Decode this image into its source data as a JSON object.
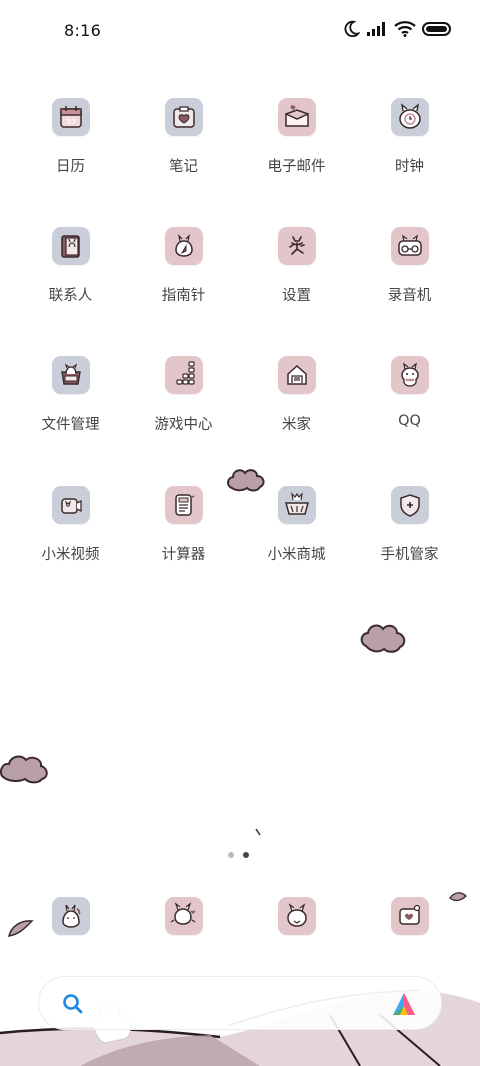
{
  "status_bar": {
    "time": "8:16",
    "icons": [
      "moon-icon",
      "signal-icon",
      "wifi-icon",
      "battery-icon"
    ]
  },
  "apps": [
    {
      "name": "日历",
      "icon": "calendar-icon",
      "tile": "blue"
    },
    {
      "name": "笔记",
      "icon": "notes-icon",
      "tile": "blue"
    },
    {
      "name": "电子邮件",
      "icon": "email-icon",
      "tile": "pink"
    },
    {
      "name": "时钟",
      "icon": "clock-icon",
      "tile": "blue"
    },
    {
      "name": "联系人",
      "icon": "contacts-icon",
      "tile": "blue"
    },
    {
      "name": "指南针",
      "icon": "compass-icon",
      "tile": "pink"
    },
    {
      "name": "设置",
      "icon": "settings-icon",
      "tile": "pink"
    },
    {
      "name": "录音机",
      "icon": "recorder-icon",
      "tile": "pink"
    },
    {
      "name": "文件管理",
      "icon": "files-icon",
      "tile": "blue"
    },
    {
      "name": "游戏中心",
      "icon": "game-center-icon",
      "tile": "pink"
    },
    {
      "name": "米家",
      "icon": "mi-home-icon",
      "tile": "pink"
    },
    {
      "name": "QQ",
      "icon": "qq-icon",
      "tile": "pink"
    },
    {
      "name": "小米视频",
      "icon": "video-icon",
      "tile": "blue"
    },
    {
      "name": "计算器",
      "icon": "calculator-icon",
      "tile": "pink"
    },
    {
      "name": "小米商城",
      "icon": "mi-store-icon",
      "tile": "blue"
    },
    {
      "name": "手机管家",
      "icon": "security-icon",
      "tile": "blue"
    }
  ],
  "page_indicator": {
    "count": 2,
    "active": 2
  },
  "dock": [
    {
      "icon": "phone-icon",
      "tile": "blue"
    },
    {
      "icon": "messages-icon",
      "tile": "pink"
    },
    {
      "icon": "browser-icon",
      "tile": "pink"
    },
    {
      "icon": "camera-icon",
      "tile": "pink"
    }
  ],
  "search_bar": {
    "icon": "search-icon",
    "assistant_icon": "assistant-icon"
  },
  "colors": {
    "tile_blue": "#c9ced9",
    "tile_pink": "#e2c6c9",
    "icon_stroke": "#3a2a2c",
    "search_accent": "#1e88e5"
  }
}
